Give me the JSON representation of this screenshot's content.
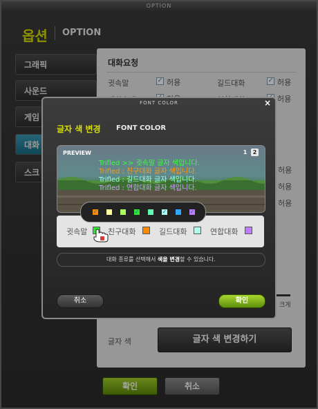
{
  "window": {
    "title": "OPTION"
  },
  "header": {
    "title_ko": "옵션",
    "title_en": "OPTION"
  },
  "tabs": [
    {
      "label": "그래픽",
      "active": false
    },
    {
      "label": "사운드",
      "active": false
    },
    {
      "label": "게임",
      "active": false
    },
    {
      "label": "대화",
      "active": true
    },
    {
      "label": "스크",
      "active": false
    }
  ],
  "content": {
    "section_title": "대화요청",
    "rows": [
      {
        "left_label": "귓속말",
        "left_check": "허용",
        "right_label": "길드대화",
        "right_check": "허용"
      },
      {
        "left_label": "대화초대",
        "left_check": "허용",
        "right_label": "연합대화",
        "right_check": "허용"
      }
    ],
    "hidden_checks": [
      "허용",
      "허용",
      "허용"
    ],
    "partial_text": "크게",
    "font_color_label": "글자 색",
    "font_color_button": "글자 색 변경하기"
  },
  "bottom": {
    "ok": "확인",
    "cancel": "취소"
  },
  "dialog": {
    "title_bar": "FONT COLOR",
    "close": "×",
    "title_ko": "글자 색 변경",
    "title_en": "FONT COLOR",
    "preview_label": "PREVIEW",
    "pages": [
      "1",
      "2"
    ],
    "preview_lines": [
      {
        "text": "Trifled >> 귓속말 글자 색입니다.",
        "color": "#3cff3c"
      },
      {
        "text": "Trifled : 친구대화 글자 색입니다.",
        "color": "#ff9a1a"
      },
      {
        "text": "Trifled : 길드대화 글자 색입니다.",
        "color": "#9cfff0"
      },
      {
        "text": "Trifled : 연합대화 글자 색입니다.",
        "color": "#d79cff"
      }
    ],
    "swatches": [
      "#ff8a00",
      "#ffffa0",
      "#a8ff60",
      "#2ee82e",
      "#60ffb0",
      "#a8fff0",
      "#2ea8ff",
      "#c07cff"
    ],
    "chat_types": [
      {
        "label": "귓속말",
        "color": "#2ee82e"
      },
      {
        "label": "친구대화",
        "color": "#ff8a00"
      },
      {
        "label": "길드대화",
        "color": "#a8fff0"
      },
      {
        "label": "연합대화",
        "color": "#c07cff"
      }
    ],
    "hint_pre": "대화 종류를 선택해서 ",
    "hint_bold": "색을 변경",
    "hint_post": "할 수 있습니다.",
    "cancel": "취소",
    "ok": "확인"
  }
}
